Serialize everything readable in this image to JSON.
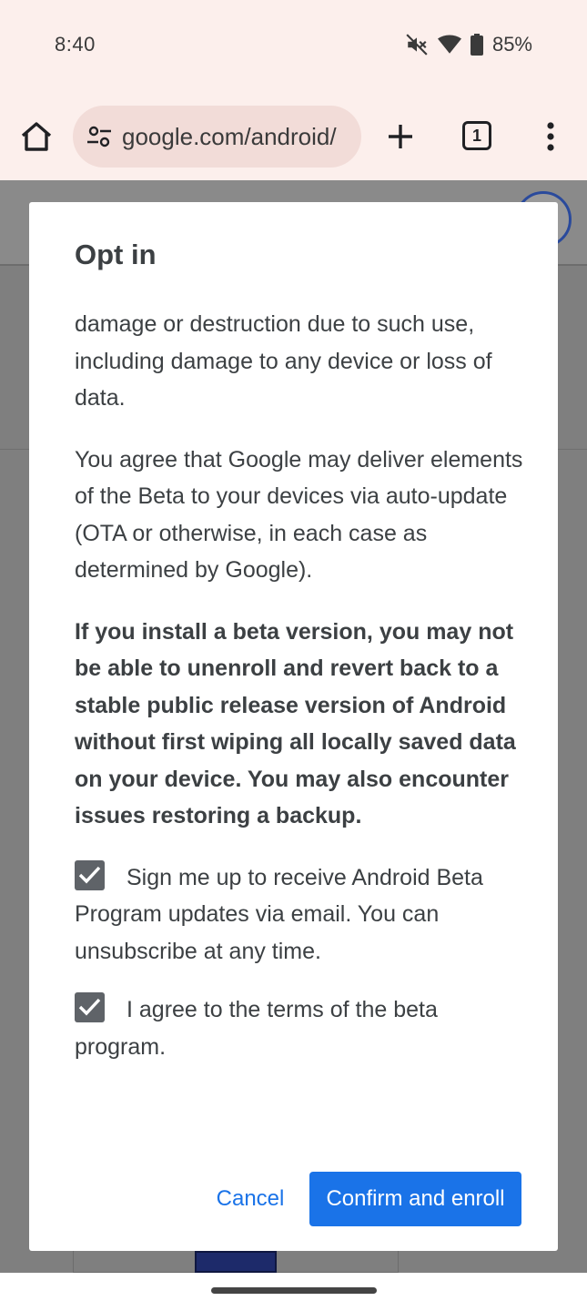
{
  "status_bar": {
    "time": "8:40",
    "battery_percent": "85%",
    "icons": [
      "mute-icon",
      "wifi-icon",
      "battery-icon"
    ]
  },
  "browser": {
    "url": "google.com/android/",
    "tab_count": "1",
    "icons": [
      "home-icon",
      "site-settings-icon",
      "new-tab-icon",
      "tab-switcher-icon",
      "overflow-menu-icon"
    ]
  },
  "dialog": {
    "title": "Opt in",
    "paragraphs": [
      "damage or destruction due to such use, including damage to any device or loss of data.",
      "You agree that Google may deliver elements of the Beta to your devices via auto-update (OTA or otherwise, in each case as determined by Google)."
    ],
    "warning": "If you install a beta version, you may not be able to unenroll and revert back to a stable public release version of Android without first wiping all locally saved data on your device. You may also encounter issues restoring a backup.",
    "checkboxes": [
      {
        "label": "Sign me up to receive Android Beta Program updates via email. You can unsubscribe at any time.",
        "checked": true
      },
      {
        "label": "I agree to the terms of the beta program.",
        "checked": true
      }
    ],
    "cancel_label": "Cancel",
    "confirm_label": "Confirm and enroll"
  },
  "colors": {
    "accent": "#1a73e8",
    "chrome_bg": "#fcefec",
    "omnibox_bg": "#f2dcd8",
    "scrim": "#7f7f7f",
    "checkbox": "#5f6368"
  }
}
